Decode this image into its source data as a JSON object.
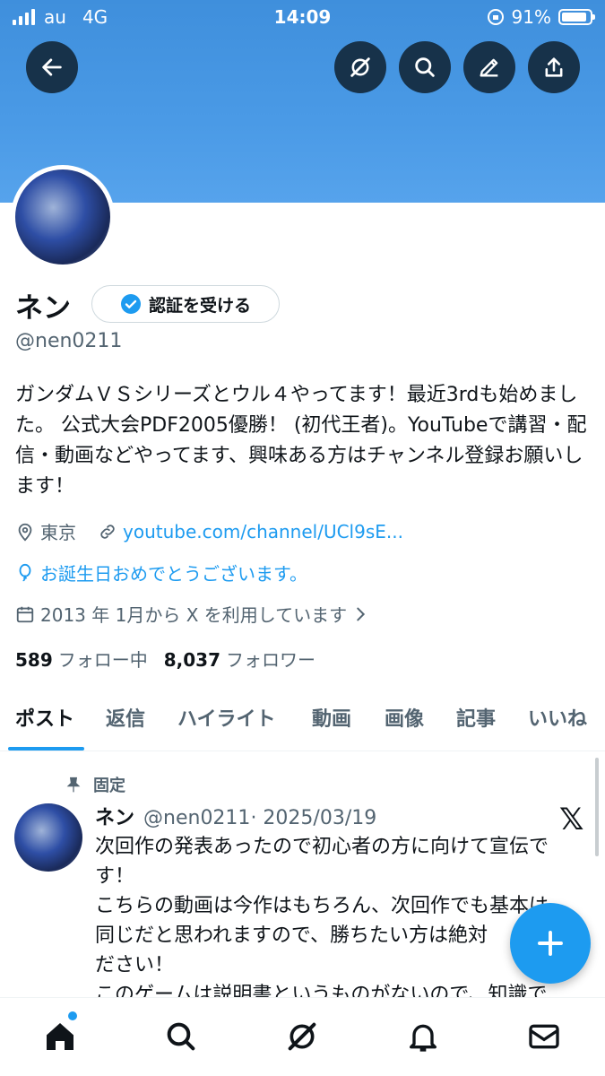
{
  "status_bar": {
    "carrier": "au",
    "network": "4G",
    "time": "14:09",
    "battery": "91%",
    "battery_level": 0.91
  },
  "top_actions": {
    "back": "arrow-left-icon",
    "grok": "grok-icon",
    "search": "search-icon",
    "edit": "pencil-icon",
    "share": "share-icon"
  },
  "profile": {
    "name": "ネン",
    "verify_label": "認証を受ける",
    "handle": "@nen0211",
    "bio": "ガンダムＶＳシリーズとウル４やってます！最近3rdも始めました。 公式大会PDF2005優勝！ (初代王者)。YouTubeで講習・配信・動画などやってます、興味ある方はチャンネル登録お願いします！",
    "location": "東京",
    "website": "youtube.com/channel/UCl9sE...",
    "birthday": "お誕生日おめでとうございます。",
    "joined": "2013 年 1月から X を利用しています",
    "following_count": "589",
    "following_label": "フォロー中",
    "followers_count": "8,037",
    "followers_label": "フォロワー"
  },
  "tabs": [
    {
      "label": "ポスト",
      "active": true
    },
    {
      "label": "返信"
    },
    {
      "label": "ハイライト"
    },
    {
      "label": "動画"
    },
    {
      "label": "画像"
    },
    {
      "label": "記事"
    },
    {
      "label": "いいね"
    }
  ],
  "pinned_post": {
    "pinned_label": "固定",
    "author": "ネン",
    "handle": "@nen0211",
    "date": "· 2025/03/19",
    "lines": [
      "次回作の発表あったので初心者の方に向けて宣伝で",
      "す！",
      "こちらの動画は今作はもちろん、次回作でも基本は",
      "同じだと思われますので、勝ちたい方は絶対",
      "ださい！",
      "このゲームは説明書というものがないので、知識で"
    ]
  },
  "compose": "plus-icon",
  "bottom_nav": [
    "home-icon",
    "search-icon",
    "grok-icon",
    "bell-icon",
    "mail-icon"
  ],
  "colors": {
    "banner": "#4a9ae6",
    "accent": "#1d9bf0",
    "text": "#0f1419",
    "muted": "#536471"
  }
}
